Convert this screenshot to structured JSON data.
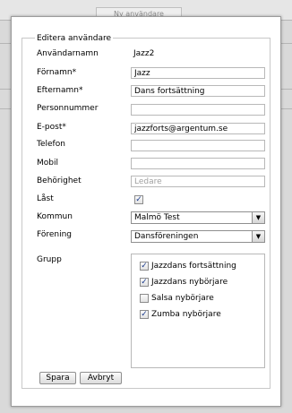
{
  "background": {
    "tab_label": "Ny användare"
  },
  "form": {
    "legend": "Editera användare",
    "fields": {
      "username": {
        "label": "Användarnamn",
        "value": "Jazz2"
      },
      "firstname": {
        "label": "Förnamn*",
        "value": "Jazz"
      },
      "lastname": {
        "label": "Efternamn*",
        "value": "Dans fortsättning"
      },
      "personnummer": {
        "label": "Personnummer",
        "value": ""
      },
      "email": {
        "label": "E-post*",
        "value": "jazzforts@argentum.se"
      },
      "telefon": {
        "label": "Telefon",
        "value": ""
      },
      "mobil": {
        "label": "Mobil",
        "value": ""
      },
      "behorighet": {
        "label": "Behörighet",
        "value": "Ledare"
      },
      "last": {
        "label": "Låst",
        "checked": true
      },
      "kommun": {
        "label": "Kommun",
        "value": "Malmö Test"
      },
      "forening": {
        "label": "Förening",
        "value": "Dansföreningen"
      }
    },
    "grupp": {
      "label": "Grupp",
      "items": [
        {
          "label": "Jazzdans fortsättning",
          "checked": true
        },
        {
          "label": "Jazzdans nybörjare",
          "checked": true
        },
        {
          "label": "Salsa nybörjare",
          "checked": false
        },
        {
          "label": "Zumba nybörjare",
          "checked": true
        }
      ]
    },
    "buttons": {
      "save": "Spara",
      "cancel": "Avbryt"
    }
  },
  "colors": {
    "check_mark": "#1a3a8c",
    "disabled_text": "#a0a0a0"
  }
}
